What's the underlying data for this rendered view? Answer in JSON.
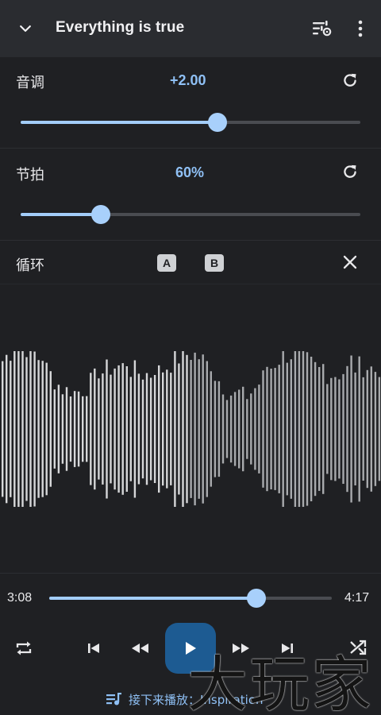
{
  "header": {
    "title": "Everything is true"
  },
  "pitch": {
    "label": "音调",
    "value": "+2.00",
    "level": 0.58
  },
  "tempo": {
    "label": "节拍",
    "value": "60%",
    "level": 0.235
  },
  "loop": {
    "label": "循环",
    "a_label": "A",
    "b_label": "B"
  },
  "playback": {
    "elapsed": "3:08",
    "total": "4:17",
    "progress": 0.732
  },
  "up_next": {
    "text": "接下来播放：Inspiration"
  },
  "watermark": {
    "text": "大玩家"
  },
  "colors": {
    "accent": "#8fc0f5",
    "slider_fill": "#a3cdf9",
    "play_button": "#1d5b92",
    "header_bg": "#2a2c30",
    "background": "#1f2023"
  },
  "icons": {
    "back": "chevron-down-icon",
    "equalizer": "equalizer-settings-icon",
    "more": "more-vert-icon",
    "reset": "refresh-icon",
    "close": "close-icon",
    "repeat": "repeat-icon",
    "previous": "skip-previous-icon",
    "rewind": "rewind-icon",
    "play": "play-icon",
    "fast_forward": "fast-forward-icon",
    "next": "skip-next-icon",
    "shuffle": "shuffle-icon",
    "queue": "queue-music-icon"
  }
}
